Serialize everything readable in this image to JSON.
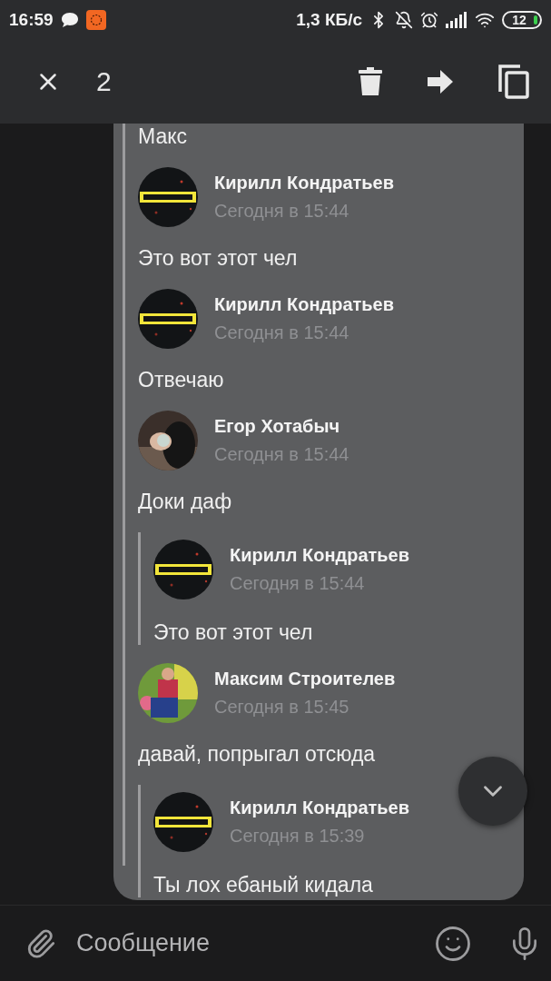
{
  "status_bar": {
    "time": "16:59",
    "network_speed": "1,3 КБ/с",
    "battery": "12"
  },
  "selection_bar": {
    "count": "2"
  },
  "messages": [
    {
      "kind": "text",
      "text": "Макс"
    },
    {
      "kind": "author",
      "author": "Кирилл Кондратьев",
      "time": "Сегодня в 15:44"
    },
    {
      "kind": "text",
      "text": "Это вот этот чел"
    },
    {
      "kind": "author",
      "author": "Кирилл Кондратьев",
      "time": "Сегодня в 15:44"
    },
    {
      "kind": "text",
      "text": "Отвечаю"
    },
    {
      "kind": "author",
      "author": "Егор Хотабыч",
      "time": "Сегодня в 15:44"
    },
    {
      "kind": "text",
      "text": "Доки даф"
    },
    {
      "kind": "quote",
      "author": "Кирилл Кондратьев",
      "time": "Сегодня в 15:44",
      "text": "Это вот этот чел"
    },
    {
      "kind": "author",
      "author": "Максим Строителев",
      "time": "Сегодня в 15:45"
    },
    {
      "kind": "text",
      "text": "давай, попрыгал отсюда"
    },
    {
      "kind": "quote",
      "author": "Кирилл Кондратьев",
      "time": "Сегодня в 15:39",
      "text": "Ты лох ебаный кидала"
    }
  ],
  "composer": {
    "placeholder": "Сообщение"
  }
}
